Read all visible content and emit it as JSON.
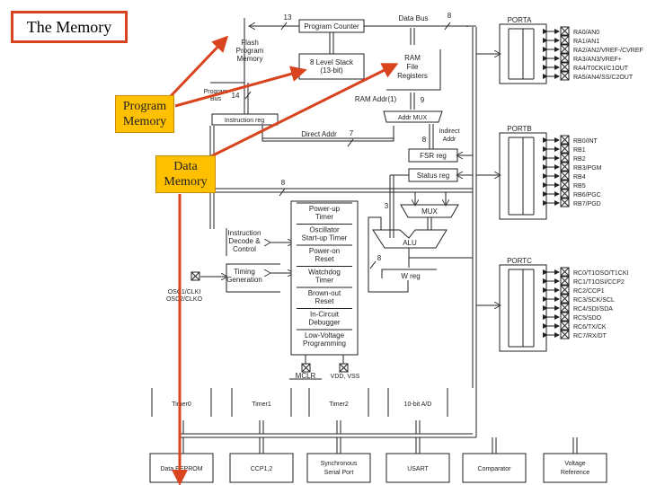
{
  "title": "The Memory",
  "callouts": {
    "program_memory": "Program\nMemory",
    "data_memory": "Data\nMemory"
  },
  "colors": {
    "arrow": "#d9431e",
    "callout_fill": "#ffc000",
    "title_border": "#d9431e",
    "line": "#222222"
  },
  "diagram": {
    "flash_program_memory": [
      "Flash",
      "Program",
      "Memory"
    ],
    "program_counter": "Program Counter",
    "stack": [
      "8 Level Stack",
      "(13-bit)"
    ],
    "data_bus": "Data Bus",
    "data_bus_width": "8",
    "pc_width": "13",
    "program_bus": [
      "Program",
      "Bus"
    ],
    "program_bus_width": "14",
    "ram_file_registers": [
      "RAM",
      "File",
      "Registers"
    ],
    "ram_addr": "RAM Addr",
    "ram_addr_note": "(1)",
    "ram_addr_width": "9",
    "addr_mux": "Addr MUX",
    "instruction_reg": "Instruction reg",
    "direct_addr": "Direct Addr",
    "direct_addr_width": "7",
    "indirect_addr": [
      "Indirect",
      "Addr"
    ],
    "indirect_width": "8",
    "fsr_reg": "FSR reg",
    "status_reg": "Status reg",
    "bus8_label": "8",
    "mux": "MUX",
    "alu": "ALU",
    "alu_status_width": "3",
    "w_width": "8",
    "w_reg": "W reg",
    "instruction_decode": [
      "Instruction",
      "Decode &",
      "Control"
    ],
    "timing_generation": [
      "Timing",
      "Generation"
    ],
    "osc_pins": [
      "OSC1/CLKI",
      "OSC2/CLKO"
    ],
    "special_blocks": [
      [
        "Power-up",
        "Timer"
      ],
      [
        "Oscillator",
        "Start-up Timer"
      ],
      [
        "Power-on",
        "Reset"
      ],
      [
        "Watchdog",
        "Timer"
      ],
      [
        "Brown-out",
        "Reset"
      ],
      [
        "In-Circuit",
        "Debugger"
      ],
      [
        "Low-Voltage",
        "Programming"
      ]
    ],
    "mclr": "MCLR",
    "vdd_vss": "VDD, VSS",
    "porta": {
      "label": "PORTA",
      "pins": [
        "RA0/AN0",
        "RA1/AN1",
        "RA2/AN2/VREF-/CVREF",
        "RA3/AN3/VREF+",
        "RA4/T0CKI/C1OUT",
        "RA5/AN4/SS/C2OUT"
      ]
    },
    "portb": {
      "label": "PORTB",
      "pins": [
        "RB0/INT",
        "RB1",
        "RB2",
        "RB3/PGM",
        "RB4",
        "RB5",
        "RB6/PGC",
        "RB7/PGD"
      ]
    },
    "portc": {
      "label": "PORTC",
      "pins": [
        "RC0/T1OSO/T1CKI",
        "RC1/T1OSI/CCP2",
        "RC2/CCP1",
        "RC3/SCK/SCL",
        "RC4/SDI/SDA",
        "RC5/SDO",
        "RC6/TX/CK",
        "RC7/RX/DT"
      ]
    },
    "peripherals_top": [
      "Timer0",
      "Timer1",
      "Timer2",
      "10-bit A/D"
    ],
    "peripherals_bottom": [
      "Data EEPROM",
      "CCP1,2",
      [
        "Synchronous",
        "Serial Port"
      ],
      "USART",
      "Comparator",
      [
        "Voltage",
        "Reference"
      ]
    ]
  }
}
